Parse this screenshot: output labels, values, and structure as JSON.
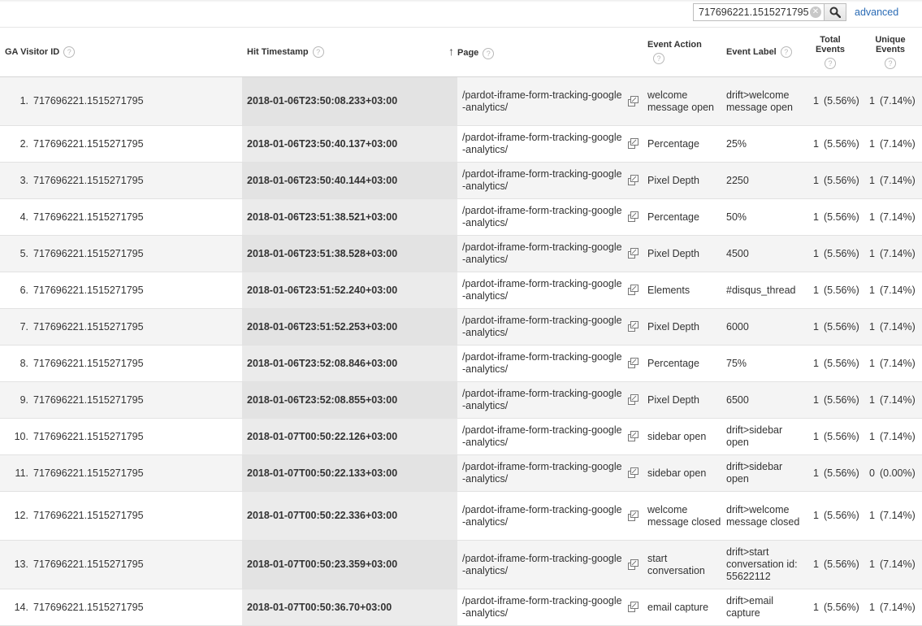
{
  "search": {
    "value": "717696221.1515271795",
    "clear_icon": "clear-icon",
    "button_icon": "search-icon"
  },
  "advanced_label": "advanced",
  "columns": {
    "visitor": "GA Visitor ID",
    "timestamp": "Hit Timestamp",
    "page": "Page",
    "action": "Event Action",
    "label": "Event Label",
    "total": "Total Events",
    "unique": "Unique Events",
    "help_glyph": "?",
    "sort_glyph": "↑"
  },
  "rows": [
    {
      "idx": "1.",
      "visitor": "717696221.1515271795",
      "ts": "2018-01-06T23:50:08.233+03:00",
      "page": "/pardot-iframe-form-tracking-google-analytics/",
      "action": "welcome message open",
      "label": "drift>welcome message open",
      "total": "1",
      "total_pct": "(5.56%)",
      "unique": "1",
      "unique_pct": "(7.14%)"
    },
    {
      "idx": "2.",
      "visitor": "717696221.1515271795",
      "ts": "2018-01-06T23:50:40.137+03:00",
      "page": "/pardot-iframe-form-tracking-google-analytics/",
      "action": "Percentage",
      "label": "25%",
      "total": "1",
      "total_pct": "(5.56%)",
      "unique": "1",
      "unique_pct": "(7.14%)"
    },
    {
      "idx": "3.",
      "visitor": "717696221.1515271795",
      "ts": "2018-01-06T23:50:40.144+03:00",
      "page": "/pardot-iframe-form-tracking-google-analytics/",
      "action": "Pixel Depth",
      "label": "2250",
      "total": "1",
      "total_pct": "(5.56%)",
      "unique": "1",
      "unique_pct": "(7.14%)"
    },
    {
      "idx": "4.",
      "visitor": "717696221.1515271795",
      "ts": "2018-01-06T23:51:38.521+03:00",
      "page": "/pardot-iframe-form-tracking-google-analytics/",
      "action": "Percentage",
      "label": "50%",
      "total": "1",
      "total_pct": "(5.56%)",
      "unique": "1",
      "unique_pct": "(7.14%)"
    },
    {
      "idx": "5.",
      "visitor": "717696221.1515271795",
      "ts": "2018-01-06T23:51:38.528+03:00",
      "page": "/pardot-iframe-form-tracking-google-analytics/",
      "action": "Pixel Depth",
      "label": "4500",
      "total": "1",
      "total_pct": "(5.56%)",
      "unique": "1",
      "unique_pct": "(7.14%)"
    },
    {
      "idx": "6.",
      "visitor": "717696221.1515271795",
      "ts": "2018-01-06T23:51:52.240+03:00",
      "page": "/pardot-iframe-form-tracking-google-analytics/",
      "action": "Elements",
      "label": "#disqus_thread",
      "total": "1",
      "total_pct": "(5.56%)",
      "unique": "1",
      "unique_pct": "(7.14%)"
    },
    {
      "idx": "7.",
      "visitor": "717696221.1515271795",
      "ts": "2018-01-06T23:51:52.253+03:00",
      "page": "/pardot-iframe-form-tracking-google-analytics/",
      "action": "Pixel Depth",
      "label": "6000",
      "total": "1",
      "total_pct": "(5.56%)",
      "unique": "1",
      "unique_pct": "(7.14%)"
    },
    {
      "idx": "8.",
      "visitor": "717696221.1515271795",
      "ts": "2018-01-06T23:52:08.846+03:00",
      "page": "/pardot-iframe-form-tracking-google-analytics/",
      "action": "Percentage",
      "label": "75%",
      "total": "1",
      "total_pct": "(5.56%)",
      "unique": "1",
      "unique_pct": "(7.14%)"
    },
    {
      "idx": "9.",
      "visitor": "717696221.1515271795",
      "ts": "2018-01-06T23:52:08.855+03:00",
      "page": "/pardot-iframe-form-tracking-google-analytics/",
      "action": "Pixel Depth",
      "label": "6500",
      "total": "1",
      "total_pct": "(5.56%)",
      "unique": "1",
      "unique_pct": "(7.14%)"
    },
    {
      "idx": "10.",
      "visitor": "717696221.1515271795",
      "ts": "2018-01-07T00:50:22.126+03:00",
      "page": "/pardot-iframe-form-tracking-google-analytics/",
      "action": "sidebar open",
      "label": "drift>sidebar open",
      "total": "1",
      "total_pct": "(5.56%)",
      "unique": "1",
      "unique_pct": "(7.14%)"
    },
    {
      "idx": "11.",
      "visitor": "717696221.1515271795",
      "ts": "2018-01-07T00:50:22.133+03:00",
      "page": "/pardot-iframe-form-tracking-google-analytics/",
      "action": "sidebar open",
      "label": "drift>sidebar open",
      "total": "1",
      "total_pct": "(5.56%)",
      "unique": "0",
      "unique_pct": "(0.00%)"
    },
    {
      "idx": "12.",
      "visitor": "717696221.1515271795",
      "ts": "2018-01-07T00:50:22.336+03:00",
      "page": "/pardot-iframe-form-tracking-google-analytics/",
      "action": "welcome message closed",
      "label": "drift>welcome message closed",
      "total": "1",
      "total_pct": "(5.56%)",
      "unique": "1",
      "unique_pct": "(7.14%)"
    },
    {
      "idx": "13.",
      "visitor": "717696221.1515271795",
      "ts": "2018-01-07T00:50:23.359+03:00",
      "page": "/pardot-iframe-form-tracking-google-analytics/",
      "action": "start conversation",
      "label": "drift>start conversation id: 55622112",
      "total": "1",
      "total_pct": "(5.56%)",
      "unique": "1",
      "unique_pct": "(7.14%)"
    },
    {
      "idx": "14.",
      "visitor": "717696221.1515271795",
      "ts": "2018-01-07T00:50:36.70+03:00",
      "page": "/pardot-iframe-form-tracking-google-analytics/",
      "action": "email capture",
      "label": "drift>email capture",
      "total": "1",
      "total_pct": "(5.56%)",
      "unique": "1",
      "unique_pct": "(7.14%)"
    }
  ],
  "icons": {
    "row_link": "open-in-new-window-icon"
  },
  "colors": {
    "link": "#2a6bb5",
    "row_alt": "#f4f4f4",
    "sorted_col": "#e3e3e3"
  }
}
